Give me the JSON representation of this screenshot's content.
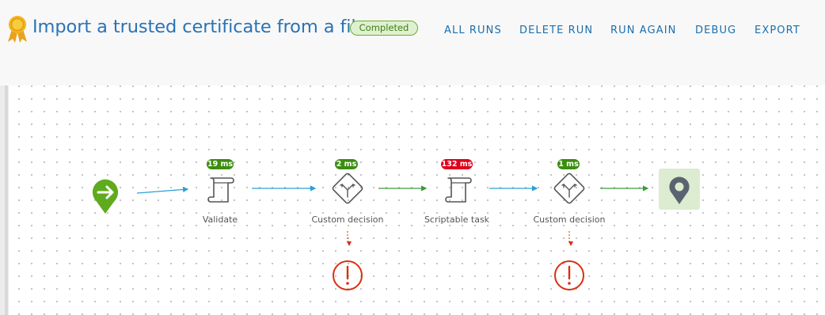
{
  "header": {
    "title": "Import a trusted certificate from a file",
    "status": "Completed",
    "icon": "award-ribbon-icon"
  },
  "actions": [
    {
      "label": "ALL RUNS"
    },
    {
      "label": "DELETE RUN"
    },
    {
      "label": "RUN AGAIN"
    },
    {
      "label": "DEBUG"
    },
    {
      "label": "EXPORT"
    }
  ],
  "workflow": {
    "nodes": [
      {
        "label": "Validate",
        "duration": "19 ms",
        "status": "ok"
      },
      {
        "label": "Custom decision",
        "duration": "2 ms",
        "status": "ok"
      },
      {
        "label": "Scriptable task",
        "duration": "132 ms",
        "status": "slow"
      },
      {
        "label": "Custom decision",
        "duration": "1 ms",
        "status": "ok"
      }
    ]
  },
  "colors": {
    "title": "#2a73b5",
    "action": "#1a6fae",
    "start": "#5faa1f",
    "success": "#3c8c10",
    "warning": "#e0001b",
    "error": "#d83010"
  }
}
